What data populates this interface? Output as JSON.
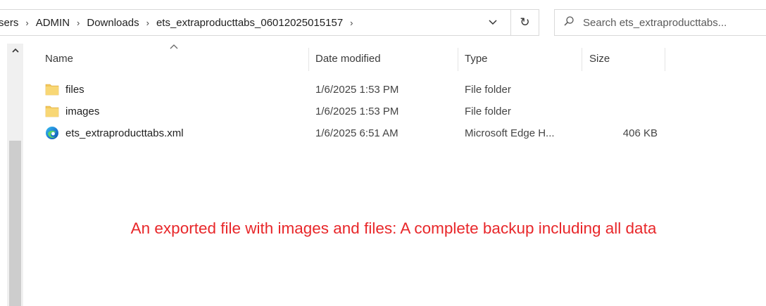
{
  "address_bar": {
    "crumbs": [
      "Users",
      "ADMIN",
      "Downloads",
      "ets_extraproducttabs_06012025015157"
    ],
    "visible_first_crumb": "sers"
  },
  "search": {
    "placeholder": "Search ets_extraproducttabs..."
  },
  "columns": {
    "name": "Name",
    "date": "Date modified",
    "type": "Type",
    "size": "Size"
  },
  "files": [
    {
      "name": "files",
      "date": "1/6/2025 1:53 PM",
      "type": "File folder",
      "size": "",
      "icon": "folder-icon"
    },
    {
      "name": "images",
      "date": "1/6/2025 1:53 PM",
      "type": "File folder",
      "size": "",
      "icon": "folder-icon"
    },
    {
      "name": "ets_extraproducttabs.xml",
      "date": "1/6/2025 6:51 AM",
      "type": "Microsoft Edge H...",
      "size": "406 KB",
      "icon": "edge-icon"
    }
  ],
  "annotation": "An exported file with images and files: A complete backup including all data",
  "colors": {
    "annotation": "#e8272a",
    "folder": "#f3c75a",
    "border": "#d9d9d9"
  }
}
